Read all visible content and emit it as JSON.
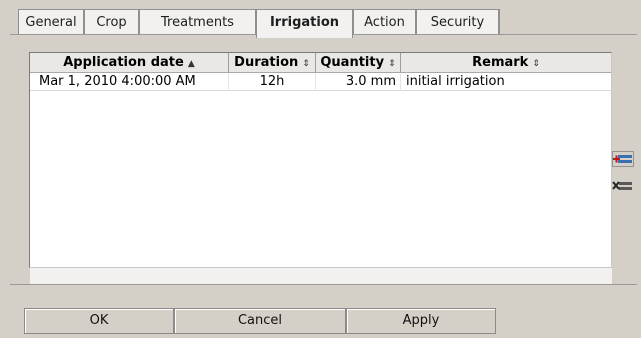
{
  "tabs": [
    {
      "label": "General",
      "active": false
    },
    {
      "label": "Crop",
      "active": false
    },
    {
      "label": "Treatments",
      "active": false
    },
    {
      "label": "Irrigation",
      "active": true
    },
    {
      "label": "Action",
      "active": false
    },
    {
      "label": "Security",
      "active": false
    }
  ],
  "table": {
    "columns": [
      {
        "label": "Application date",
        "sort_glyph": "▲"
      },
      {
        "label": "Duration",
        "sort_glyph": "⇕"
      },
      {
        "label": "Quantity",
        "sort_glyph": "⇕"
      },
      {
        "label": "Remark",
        "sort_glyph": "⇕"
      }
    ],
    "rows": [
      {
        "application_date": "Mar 1, 2010 4:00:00 AM",
        "duration": "12h",
        "quantity": "3.0 mm",
        "remark": "initial irrigation"
      }
    ]
  },
  "side_actions": {
    "add_icon": "add-row-icon",
    "remove_icon": "remove-row-icon"
  },
  "buttons": {
    "ok": "OK",
    "cancel": "Cancel",
    "apply": "Apply"
  },
  "colors": {
    "dialog_bg": "#d4d0c8",
    "add_icon_accent": "#c01818",
    "add_icon_body": "#3a6fb0"
  }
}
